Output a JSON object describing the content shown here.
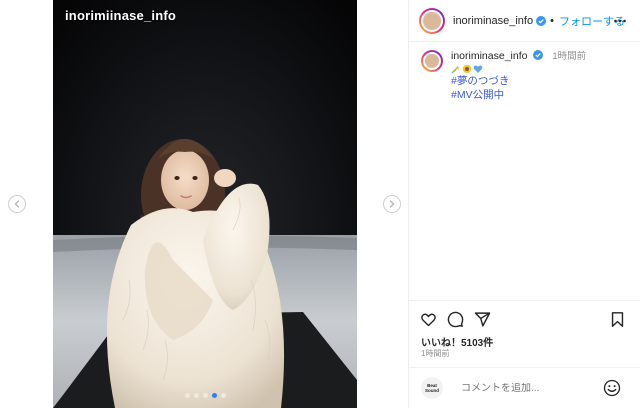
{
  "post": {
    "photo_handle": "inorimiinase_info",
    "carousel": {
      "count": 5,
      "active_index": 3
    }
  },
  "header": {
    "username": "inoriminase_info",
    "follow_label": "フォローする",
    "separator": "•",
    "more_icon": "more-horizontal-icon"
  },
  "caption": {
    "username": "inoriminase_info",
    "time_ago": "1時間前",
    "emojis": [
      "shooting-star-emoji",
      "sunflower-emoji",
      "blue-heart-emoji"
    ],
    "hashtags": [
      "#夢のつづき",
      "#MV公開中"
    ]
  },
  "actions": {
    "icons": [
      "heart-icon",
      "comment-icon",
      "share-icon",
      "bookmark-icon"
    ],
    "likes": "いいね！5103件",
    "timestamp": "1時間前"
  },
  "comment_box": {
    "logo_text": "Beat\nSound",
    "placeholder": "コメントを追加...",
    "emoji_icon": "smiley-icon"
  },
  "colors": {
    "link_blue": "#0095f6",
    "hashtag_blue": "#3b5bdb",
    "verified_blue": "#3897f0",
    "border": "#efefef"
  }
}
